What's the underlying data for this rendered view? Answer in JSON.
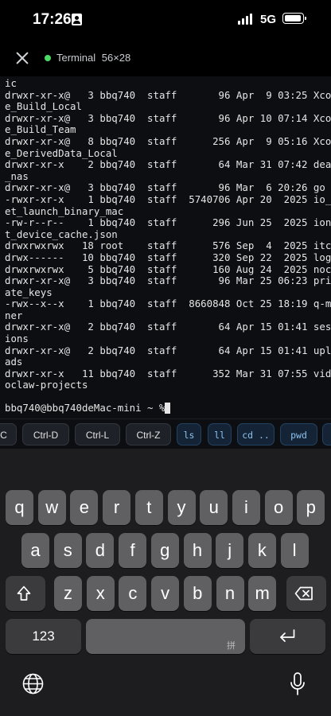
{
  "status_bar": {
    "time": "17:26",
    "network": "5G"
  },
  "header": {
    "title": "Terminal",
    "size": "56×28",
    "status_color": "#4cd964"
  },
  "terminal": {
    "lines": [
      "ic",
      "drwxr-xr-x@   3 bbq740  staff       96 Apr  9 03:25 Xcod",
      "e_Build_Local",
      "drwxr-xr-x@   3 bbq740  staff       96 Apr 10 07:14 Xcod",
      "e_Build_Team",
      "drwxr-xr-x@   8 bbq740  staff      256 Apr  9 05:16 Xcod",
      "e_DerivedData_Local",
      "drwxr-xr-x    2 bbq740  staff       64 Mar 31 07:42 dean",
      "_nas",
      "drwxr-xr-x@   3 bbq740  staff       96 Mar  6 20:26 go",
      "-rwxr-xr-x    1 bbq740  staff  5740706 Apr 20  2025 io_n",
      "et_launch_binary_mac",
      "-rw-r--r--    1 bbq740  staff      296 Jun 25  2025 ione",
      "t_device_cache.json",
      "drwxrwxrwx   18 root    staff      576 Sep  4  2025 itc",
      "drwx------   10 bbq740  staff      320 Sep 22  2025 log",
      "drwxrwxrwx    5 bbq740  staff      160 Aug 24  2025 nock",
      "drwxr-xr-x@   3 bbq740  staff       96 Mar 25 06:23 priv",
      "ate_keys",
      "-rwx--x--x    1 bbq740  staff  8660848 Oct 25 18:19 q-mi",
      "ner",
      "drwxr-xr-x@   2 bbq740  staff       64 Apr 15 01:41 sess",
      "ions",
      "drwxr-xr-x@   2 bbq740  staff       64 Apr 15 01:41 uplo",
      "ads",
      "drwxr-xr-x   11 bbq740  staff      352 Mar 31 07:55 vide",
      "oclaw-projects"
    ],
    "prompt": "bbq740@bbq740deMac-mini ~ % "
  },
  "shortcuts": [
    "C",
    "Ctrl-D",
    "Ctrl-L",
    "Ctrl-Z",
    "ls",
    "ll",
    "cd ..",
    "pwd"
  ],
  "keyboard": {
    "row1": [
      "q",
      "w",
      "e",
      "r",
      "t",
      "y",
      "u",
      "i",
      "o",
      "p"
    ],
    "row2": [
      "a",
      "s",
      "d",
      "f",
      "g",
      "h",
      "j",
      "k",
      "l"
    ],
    "row3": [
      "z",
      "x",
      "c",
      "v",
      "b",
      "n",
      "m"
    ],
    "numbers_key": "123",
    "space_mark": "拼"
  }
}
